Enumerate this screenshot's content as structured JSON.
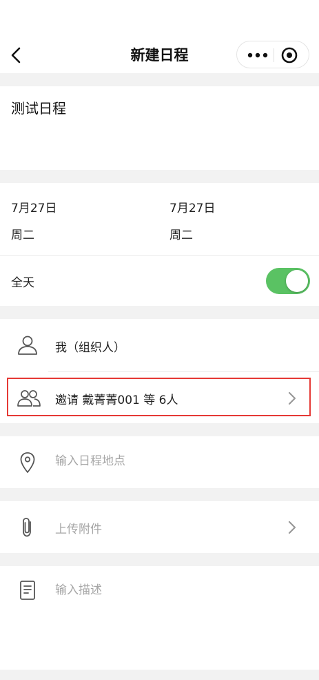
{
  "header": {
    "title": "新建日程"
  },
  "schedule": {
    "title_value": "测试日程",
    "start": {
      "date": "7月27日",
      "weekday": "周二"
    },
    "end": {
      "date": "7月27日",
      "weekday": "周二"
    },
    "all_day_label": "全天",
    "all_day_on": true
  },
  "organizer": {
    "label": "我（组织人）"
  },
  "invite": {
    "label": "邀请 戴菁菁001 等 6人"
  },
  "location": {
    "placeholder": "输入日程地点"
  },
  "attachment": {
    "placeholder": "上传附件"
  },
  "description": {
    "placeholder": "输入描述"
  },
  "colors": {
    "toggle_on": "#5ac263",
    "highlight": "#e53935"
  },
  "icons": [
    "back-arrow-icon",
    "more-dots-icon",
    "close-target-icon",
    "person-icon",
    "people-icon",
    "location-pin-icon",
    "paperclip-icon",
    "document-icon",
    "chevron-right-icon"
  ]
}
